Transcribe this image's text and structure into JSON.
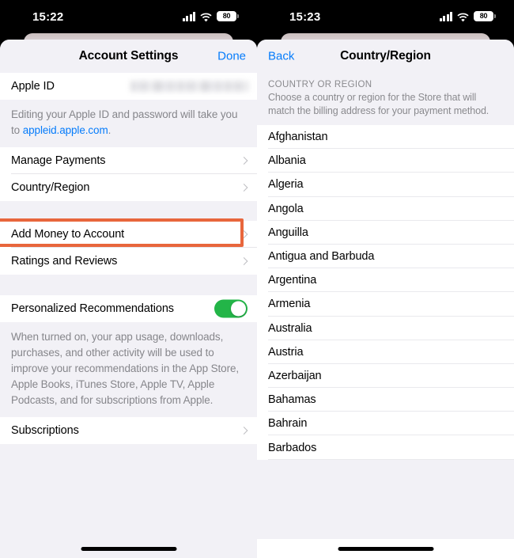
{
  "left_panel": {
    "status_bar": {
      "time": "15:22",
      "battery_level": "80",
      "cellular_icon": "cellular-bars-icon",
      "wifi_icon": "wifi-icon",
      "battery_icon": "battery-icon"
    },
    "nav": {
      "title": "Account Settings",
      "right_button": "Done"
    },
    "apple_id_row": {
      "label": "Apple ID",
      "value_redacted": ""
    },
    "apple_id_note": {
      "text_before": "Editing your Apple ID and password will take you to ",
      "link": "appleid.apple.com",
      "text_after": "."
    },
    "rows_group_1": [
      {
        "label": "Manage Payments",
        "accessory": "chevron-right-icon"
      },
      {
        "label": "Country/Region",
        "accessory": "chevron-right-icon"
      }
    ],
    "rows_group_2": [
      {
        "label": "Add Money to Account",
        "accessory": "chevron-right-icon"
      },
      {
        "label": "Ratings and Reviews",
        "accessory": "chevron-right-icon"
      }
    ],
    "toggle_row": {
      "label": "Personalized Recommendations",
      "state": "on",
      "accent_color": "#23b548"
    },
    "toggle_note": "When turned on, your app usage, downloads, purchases, and other activity will be used to improve your recommendations in the App Store, Apple Books, iTunes Store, Apple TV, Apple Podcasts, and for subscriptions from Apple.",
    "rows_group_3": [
      {
        "label": "Subscriptions",
        "accessory": "chevron-right-icon"
      }
    ],
    "highlight": {
      "target": "Country/Region",
      "color": "#e8663c"
    }
  },
  "right_panel": {
    "status_bar": {
      "time": "15:23",
      "battery_level": "80",
      "cellular_icon": "cellular-bars-icon",
      "wifi_icon": "wifi-icon",
      "battery_icon": "battery-icon"
    },
    "nav": {
      "back_button": "Back",
      "title": "Country/Region"
    },
    "section": {
      "header": "COUNTRY OR REGION",
      "description": "Choose a country or region for the Store that will match the billing address for your payment method."
    },
    "countries": [
      "Afghanistan",
      "Albania",
      "Algeria",
      "Angola",
      "Anguilla",
      "Antigua and Barbuda",
      "Argentina",
      "Armenia",
      "Australia",
      "Austria",
      "Azerbaijan",
      "Bahamas",
      "Bahrain",
      "Barbados"
    ]
  }
}
